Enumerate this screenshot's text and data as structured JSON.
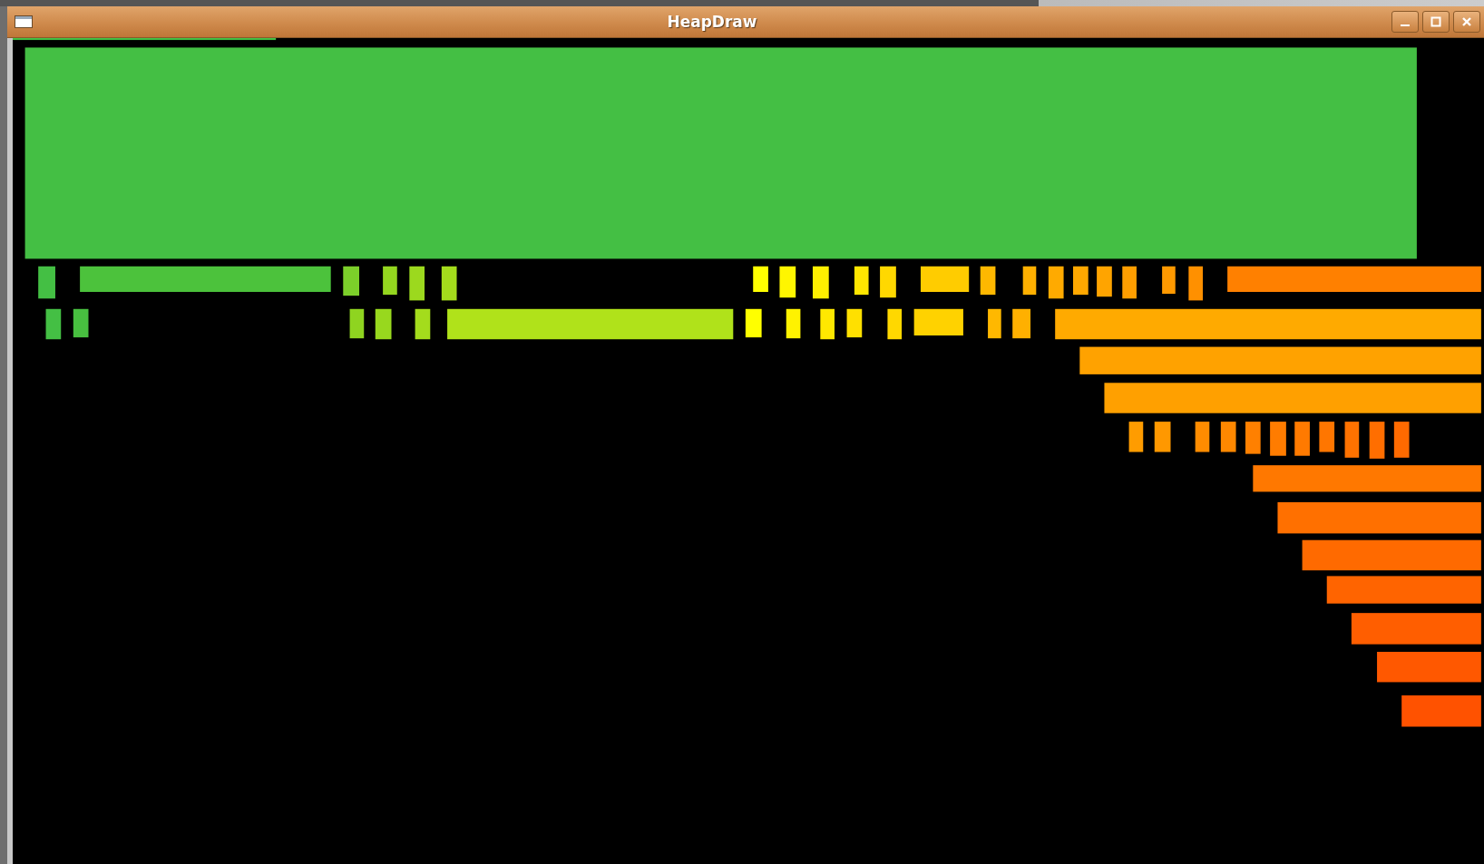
{
  "window": {
    "title": "HeapDraw"
  }
}
